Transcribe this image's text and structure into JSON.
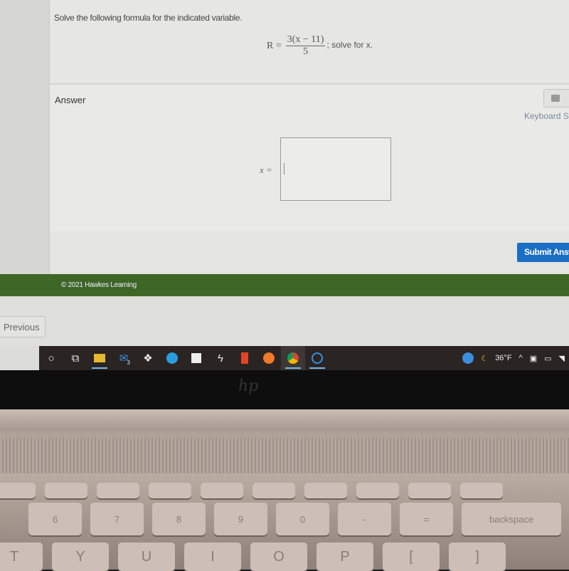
{
  "question": {
    "instruction": "Solve the following formula for the indicated variable.",
    "formula_lhs": "R =",
    "formula_numerator": "3(x − 11)",
    "formula_denominator": "5",
    "formula_suffix": "; solve for x."
  },
  "answer": {
    "label": "Answer",
    "keyboard_link": "Keyboard S",
    "variable_label": "x =",
    "input_value": "",
    "submit_label": "Submit Answer"
  },
  "footer": {
    "copyright": "© 2021 Hawkes Learning"
  },
  "nav": {
    "previous_label": "Previous"
  },
  "taskbar": {
    "apps": [
      "cortana-icon",
      "task-view-icon",
      "file-explorer-icon",
      "mail-icon",
      "dropbox-icon",
      "edge-icon",
      "store-icon",
      "bolt-icon",
      "office-icon",
      "firefox-icon",
      "chrome-icon",
      "app-icon"
    ],
    "mail_badge": "3",
    "temperature": "36°F"
  },
  "laptop": {
    "brand": "hp",
    "keys_row1": [
      "6",
      "7",
      "8",
      "9",
      "0",
      "-",
      "=",
      "backspace"
    ],
    "keys_row2": [
      "T",
      "Y",
      "U",
      "I",
      "O",
      "P",
      "[",
      "]"
    ]
  }
}
